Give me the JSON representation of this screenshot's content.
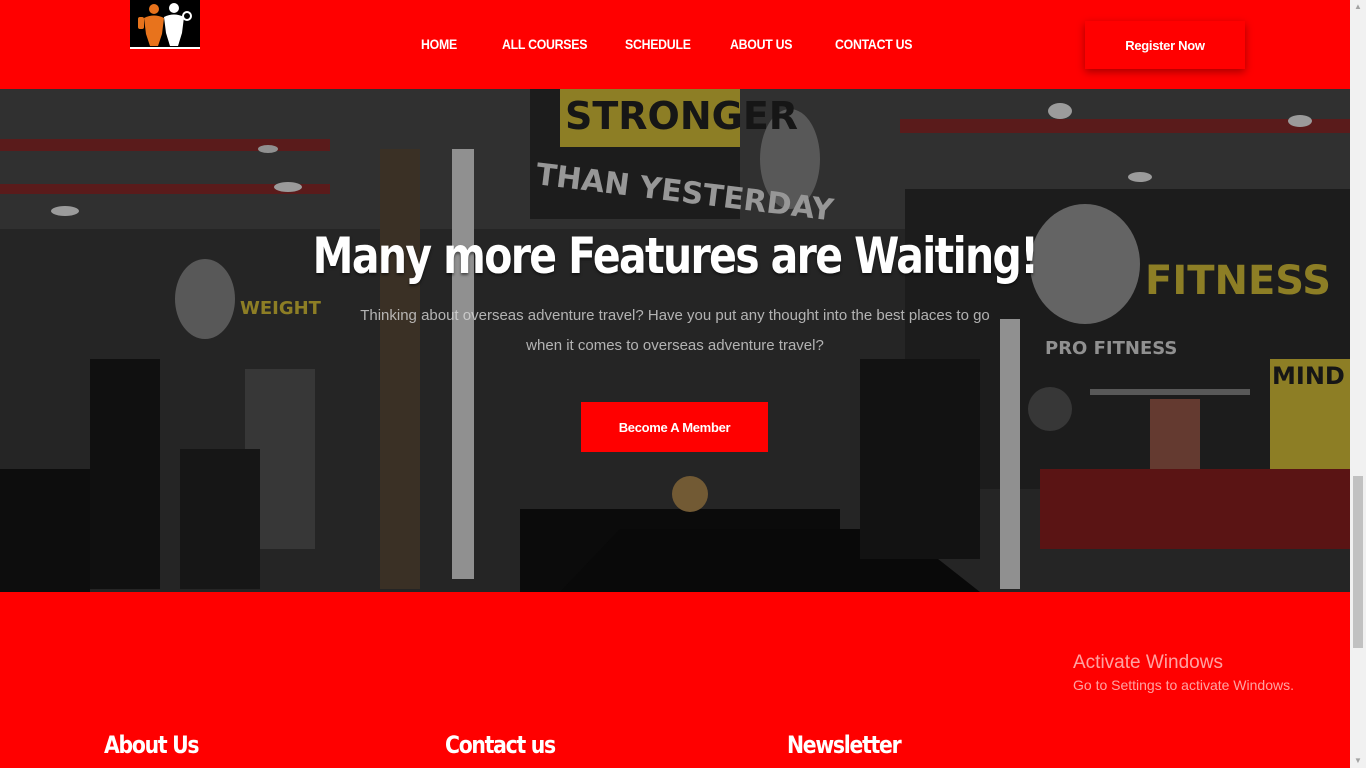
{
  "header": {
    "logo_icon": "gym-logo-icon",
    "nav": [
      {
        "label": "HOME"
      },
      {
        "label": "ALL COURSES"
      },
      {
        "label": "SCHEDULE"
      },
      {
        "label": "ABOUT US"
      },
      {
        "label": "CONTACT US"
      }
    ],
    "register_label": "Register Now"
  },
  "hero": {
    "title": "Many more Features are Waiting!",
    "subtitle": "Thinking about overseas adventure travel? Have you put any thought into the best places to go when it comes to overseas adventure travel?",
    "cta_label": "Become A Member",
    "wall_text": {
      "stronger": "STRONGER",
      "than_yesterday": "THAN YESTERDAY",
      "fitness": "FITNESS",
      "pro_fitness": "PRO FITNESS",
      "mind": "MIND",
      "weight": "WEIGHT"
    }
  },
  "footer": {
    "headings": [
      "About Us",
      "Contact us",
      "Newsletter"
    ]
  },
  "watermark": {
    "line1": "Activate Windows",
    "line2": "Go to Settings to activate Windows."
  },
  "colors": {
    "brand_red": "#ff0000",
    "white": "#ffffff",
    "logo_orange": "#e8731c"
  }
}
